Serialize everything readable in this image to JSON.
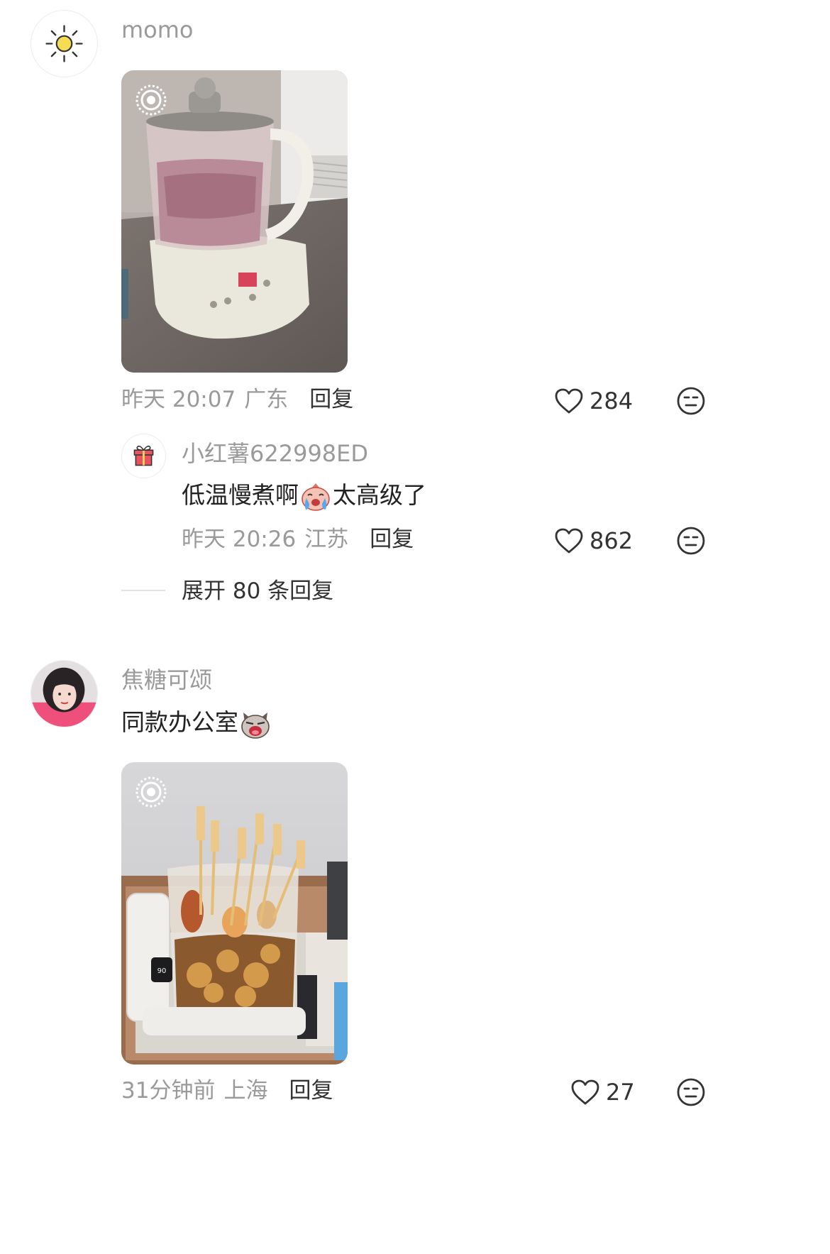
{
  "comments": [
    {
      "username": "momo",
      "avatar_icon": "sun-icon",
      "meta": {
        "time": "昨天 20:07",
        "location": "广东",
        "reply_label": "回复"
      },
      "likes": "284",
      "image": "kettle-meat-photo",
      "live_badge_icon": "live-photo-icon",
      "sub_reply": {
        "username": "小红薯622998ED",
        "avatar_icon": "gift-icon",
        "text_before": "低温慢煮啊",
        "emoji": "crying-face-emoji",
        "text_after": "太高级了",
        "meta": {
          "time": "昨天 20:26",
          "location": "江苏",
          "reply_label": "回复"
        },
        "likes": "862"
      },
      "expand_label": "展开 80 条回复"
    },
    {
      "username": "焦糖可颂",
      "avatar_icon": "girl-selfie-avatar",
      "text": "同款办公室",
      "emoji": "shocked-cat-emoji",
      "image": "kettle-skewers-photo",
      "live_badge_icon": "live-photo-icon",
      "meta": {
        "time": "31分钟前",
        "location": "上海",
        "reply_label": "回复"
      },
      "likes": "27"
    }
  ],
  "colors": {
    "username": "#9a9a9a",
    "text": "#222222",
    "meta": "#9a9a9a",
    "reply": "#333333",
    "icon": "#333333"
  }
}
